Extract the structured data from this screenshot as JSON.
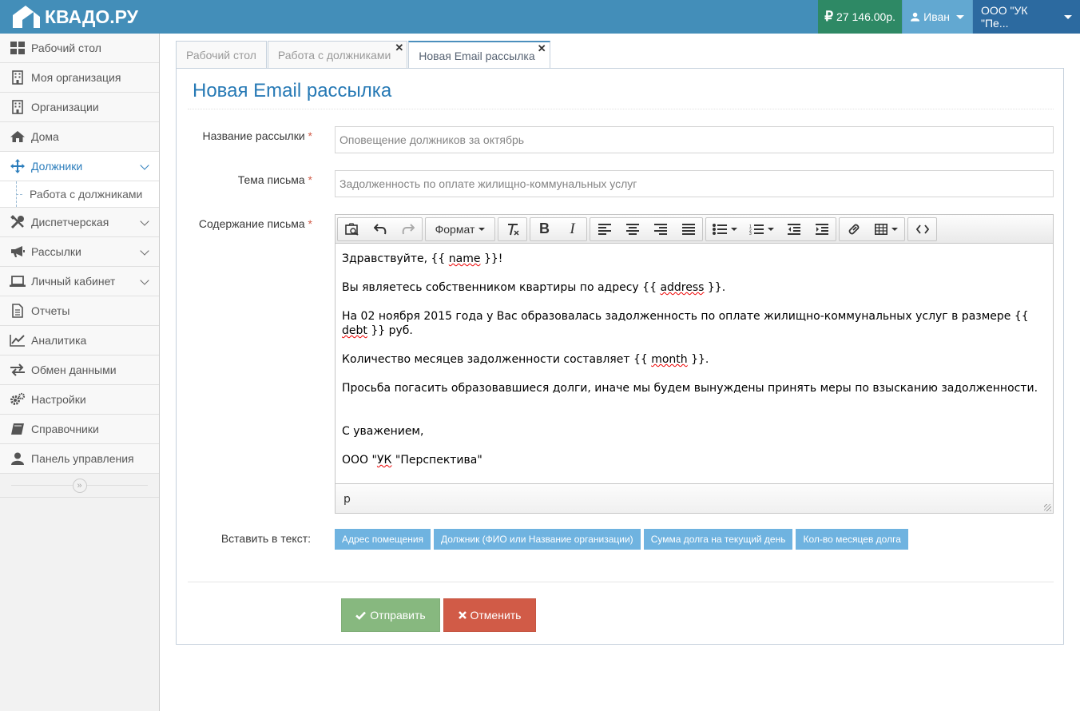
{
  "app": {
    "logo_text": "КВАДО.РУ"
  },
  "topbar": {
    "balance": "27 146.00р.",
    "user_name": "Иван",
    "org_name": "ООО \"УК \"Пе..."
  },
  "sidebar": {
    "items": [
      {
        "label": "Рабочий стол",
        "icon": "dashboard-icon"
      },
      {
        "label": "Моя организация",
        "icon": "building-icon"
      },
      {
        "label": "Организации",
        "icon": "building-icon"
      },
      {
        "label": "Дома",
        "icon": "home-icon"
      },
      {
        "label": "Должники",
        "icon": "move-icon",
        "active": true,
        "expanded": true
      },
      {
        "label": "Диспетчерская",
        "icon": "tools-icon"
      },
      {
        "label": "Рассылки",
        "icon": "bullhorn-icon"
      },
      {
        "label": "Личный кабинет",
        "icon": "laptop-icon"
      },
      {
        "label": "Отчеты",
        "icon": "file-icon"
      },
      {
        "label": "Аналитика",
        "icon": "line-chart-icon"
      },
      {
        "label": "Обмен данными",
        "icon": "exchange-icon"
      },
      {
        "label": "Настройки",
        "icon": "cogs-icon"
      },
      {
        "label": "Справочники",
        "icon": "book-icon"
      },
      {
        "label": "Панель управления",
        "icon": "user-icon"
      }
    ],
    "sub_item": "Работа с должниками"
  },
  "tabs": [
    {
      "label": "Рабочий стол",
      "closable": false
    },
    {
      "label": "Работа с должниками",
      "closable": true
    },
    {
      "label": "Новая Email рассылка",
      "closable": true,
      "active": true
    }
  ],
  "tab_close": "✕",
  "page": {
    "title": "Новая Email рассылка"
  },
  "form": {
    "name_label": "Название рассылки",
    "name_value": "Оповещение должников за октябрь",
    "subject_label": "Тема письма",
    "subject_value": "Задолженность по оплате жилищно-коммунальных услуг",
    "body_label": "Содержание письма",
    "required_mark": "*"
  },
  "editor": {
    "format_label": "Формат",
    "status_path": "p",
    "lines": {
      "l1_a": "Здравствуйте, {{ ",
      "l1_w": "name",
      "l1_b": " }}!",
      "l2_a": "Вы являетесь собственником квартиры по адресу {{ ",
      "l2_w": "address",
      "l2_b": " }}.",
      "l3_a": "На 02 ноября 2015 года у Вас образовалась задолженность по оплате жилищно-коммунальных услуг в размере {{ ",
      "l3_w": "debt",
      "l3_b": " }} руб.",
      "l4_a": "Количество месяцев задолженности составляет {{ ",
      "l4_w": "month",
      "l4_b": " }}.",
      "l5": "Просьба погасить образовавшиеся долги, иначе мы будем вынуждены принять меры по взысканию задолженности.",
      "l6": "С уважением,",
      "l7_a": "ООО \"",
      "l7_w": "УК",
      "l7_b": " \"Перспектива\""
    }
  },
  "insert": {
    "label": "Вставить в текст:",
    "buttons": [
      "Адрес помещения",
      "Должник (ФИО или Название организации)",
      "Сумма долга на текущий день",
      "Кол-во месяцев долга"
    ]
  },
  "actions": {
    "send": "Отправить",
    "cancel": "Отменить"
  },
  "colors": {
    "header": "#438eb9",
    "balance": "#2e8965",
    "accent": "#2679b5",
    "success": "#87b87f",
    "danger": "#d15b47",
    "insert_btn": "#6fb3e0"
  }
}
